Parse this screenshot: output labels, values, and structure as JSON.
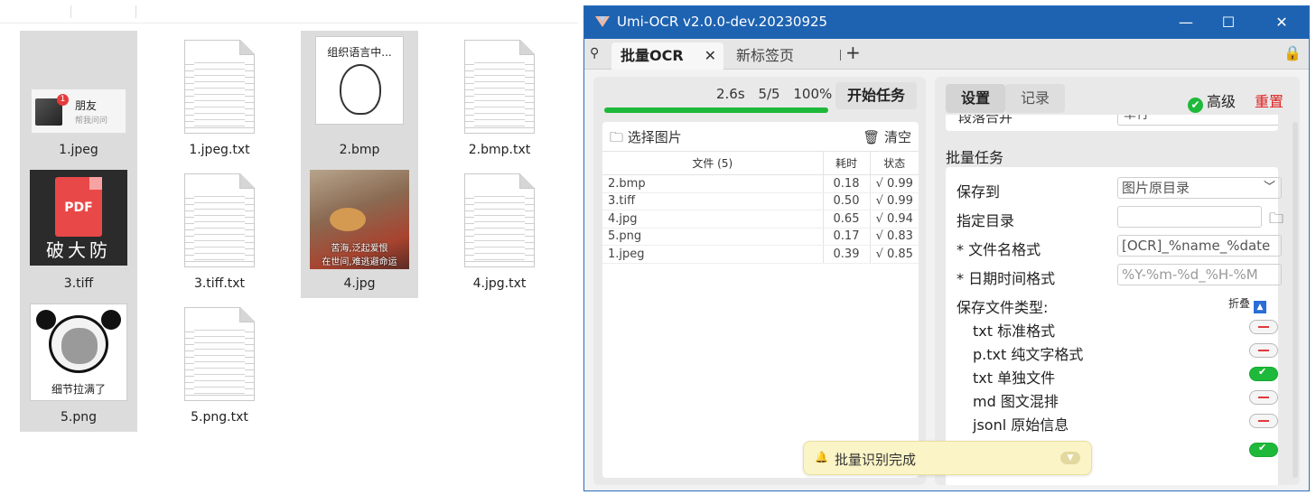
{
  "explorer": {
    "files": [
      {
        "name": "1.jpeg",
        "kind": "image"
      },
      {
        "name": "1.jpeg.txt",
        "kind": "txt"
      },
      {
        "name": "2.bmp",
        "kind": "image"
      },
      {
        "name": "2.bmp.txt",
        "kind": "txt"
      },
      {
        "name": "3.tiff",
        "kind": "image"
      },
      {
        "name": "3.tiff.txt",
        "kind": "txt"
      },
      {
        "name": "4.jpg",
        "kind": "image"
      },
      {
        "name": "4.jpg.txt",
        "kind": "txt"
      },
      {
        "name": "5.png",
        "kind": "image"
      },
      {
        "name": "5.png.txt",
        "kind": "txt"
      }
    ],
    "thumb_text": {
      "jpeg1_badge": "1",
      "jpeg1_title": "朋友",
      "jpeg1_sub": "帮我问问",
      "bmp_caption": "组织语言中...",
      "tiff_pdf": "PDF",
      "tiff_caption": "破大防",
      "jpg4_line1": "苦海,泛起爱恨",
      "jpg4_line2": "在世间,难逃避命运",
      "png_caption": "细节拉满了"
    }
  },
  "umi": {
    "title": "Umi-OCR v2.0.0-dev.20230925",
    "window_buttons": {
      "minimize": "—",
      "maximize": "☐",
      "close": "✕"
    },
    "tabs": [
      {
        "label": "批量OCR",
        "active": true,
        "close": "✕"
      },
      {
        "label": "新标签页",
        "active": false
      }
    ],
    "tab_add": "+",
    "pin_glyph": "⚲",
    "lock_glyph": "🔒",
    "stats": {
      "time": "2.6s",
      "count": "5/5",
      "percent": "100%"
    },
    "progress_fraction": 1.0,
    "start_button": "开始任务",
    "select_images": "🗀 选择图片",
    "clear": "🗑 清空",
    "table": {
      "headers": {
        "file": "文件 (5)",
        "time": "耗时",
        "status": "状态"
      },
      "rows": [
        {
          "file": "2.bmp",
          "time": "0.18",
          "status": "√ 0.99"
        },
        {
          "file": "3.tiff",
          "time": "0.50",
          "status": "√ 0.99"
        },
        {
          "file": "4.jpg",
          "time": "0.65",
          "status": "√ 0.94"
        },
        {
          "file": "5.png",
          "time": "0.17",
          "status": "√ 0.83"
        },
        {
          "file": "1.jpeg",
          "time": "0.39",
          "status": "√ 0.85"
        }
      ]
    },
    "settings": {
      "tab_settings": "设置",
      "tab_records": "记录",
      "advanced": "高级",
      "reset": "重置",
      "cut_label": "段落合并",
      "cut_value": "单行",
      "section_title": "批量任务",
      "save_to_label": "保存到",
      "save_to_value": "图片原目录",
      "dir_label": "指定目录",
      "dir_value": "",
      "filename_label": "* 文件名格式",
      "filename_value": "[OCR]_%name_%date",
      "datetime_label": "* 日期时间格式",
      "datetime_value": "%Y-%m-%d_%H-%M",
      "filetypes_label": "保存文件类型:",
      "fold_label": "折叠",
      "filetypes": [
        {
          "label": "txt 标准格式",
          "on": false
        },
        {
          "label": "p.txt 纯文字格式",
          "on": false
        },
        {
          "label": "txt 单独文件",
          "on": true
        },
        {
          "label": "md 图文混排",
          "on": false
        },
        {
          "label": "jsonl 原始信息",
          "on": false
        }
      ]
    },
    "toast": {
      "message": "批量识别完成",
      "bell": "🔔",
      "chevron": "▼"
    },
    "colors": {
      "titlebar": "#1e63b2",
      "progress": "#1eb93a",
      "toggle_on": "#1eb93a",
      "reset": "#e02020"
    }
  }
}
